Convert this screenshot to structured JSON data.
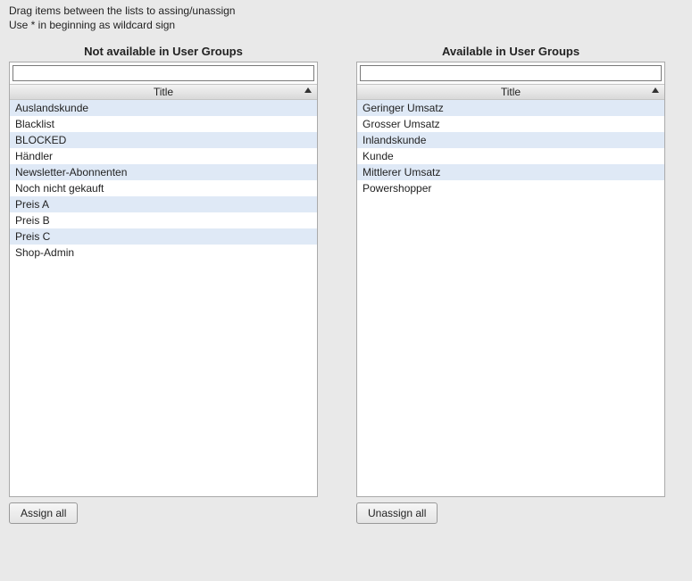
{
  "hint": {
    "line1": "Drag items between the lists to assing/unassign",
    "line2": "Use * in beginning as wildcard sign"
  },
  "left": {
    "title": "Not available in User Groups",
    "search": {
      "value": "",
      "placeholder": ""
    },
    "column_header": "Title",
    "items": [
      "Auslandskunde",
      "Blacklist",
      "BLOCKED",
      "Händler",
      "Newsletter-Abonnenten",
      "Noch nicht gekauft",
      "Preis A",
      "Preis B",
      "Preis C",
      "Shop-Admin"
    ],
    "button_label": "Assign all"
  },
  "right": {
    "title": "Available in User Groups",
    "search": {
      "value": "",
      "placeholder": ""
    },
    "column_header": "Title",
    "items": [
      "Geringer Umsatz",
      "Grosser Umsatz",
      "Inlandskunde",
      "Kunde",
      "Mittlerer Umsatz",
      "Powershopper"
    ],
    "button_label": "Unassign all"
  }
}
